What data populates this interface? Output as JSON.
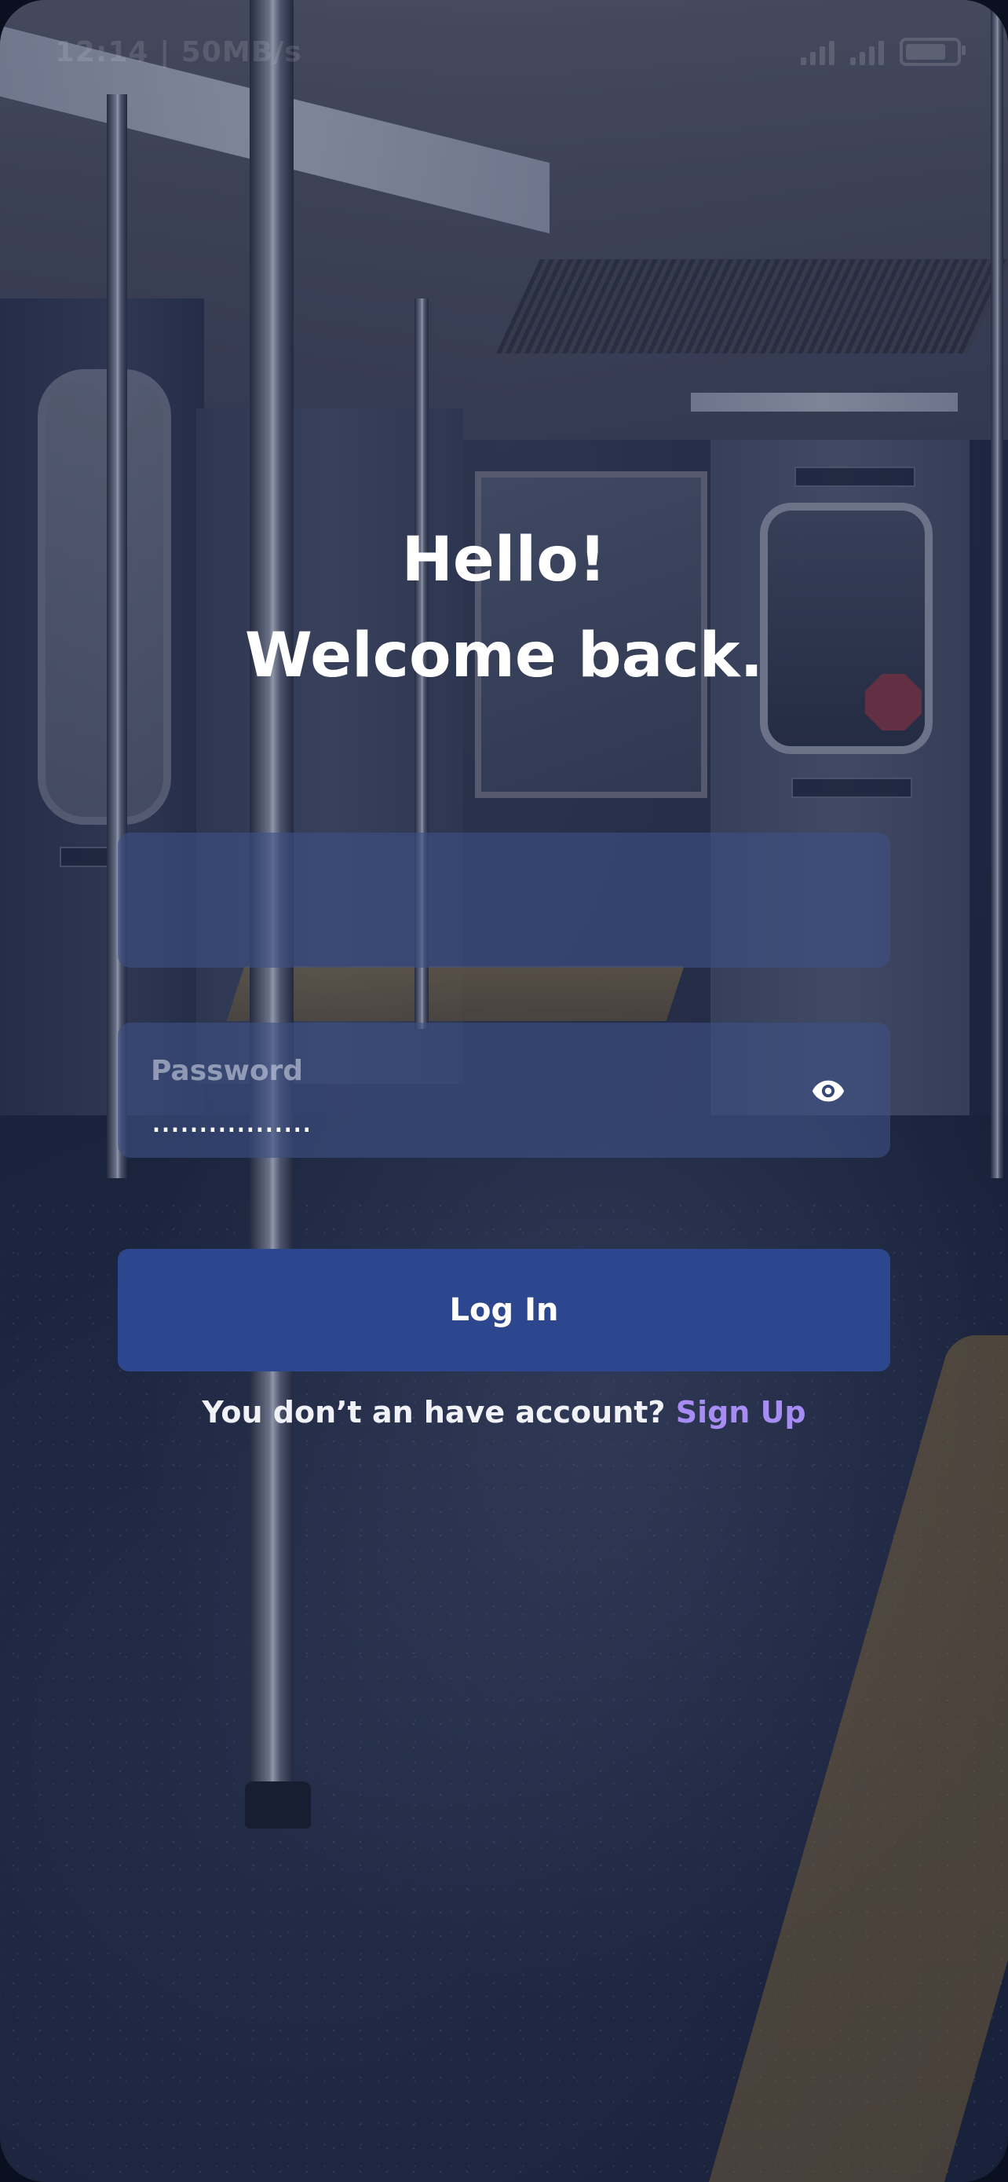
{
  "status_bar": {
    "time_speed": "12:14 | 50MB/s",
    "icons": [
      "signal-icon",
      "signal-icon",
      "battery-icon"
    ]
  },
  "heading": {
    "line1": "Hello!",
    "line2": "Welcome back."
  },
  "form": {
    "username": {
      "value": "",
      "placeholder": ""
    },
    "password": {
      "label": "Password",
      "masked_value": ".................",
      "toggle_icon": "eye-icon"
    },
    "login_label": "Log In"
  },
  "signup": {
    "prompt": "You don’t an have account?",
    "link_label": "Sign Up"
  },
  "colors": {
    "button": "#2d478f",
    "link": "#a78cf4",
    "field": "#3e5084"
  }
}
